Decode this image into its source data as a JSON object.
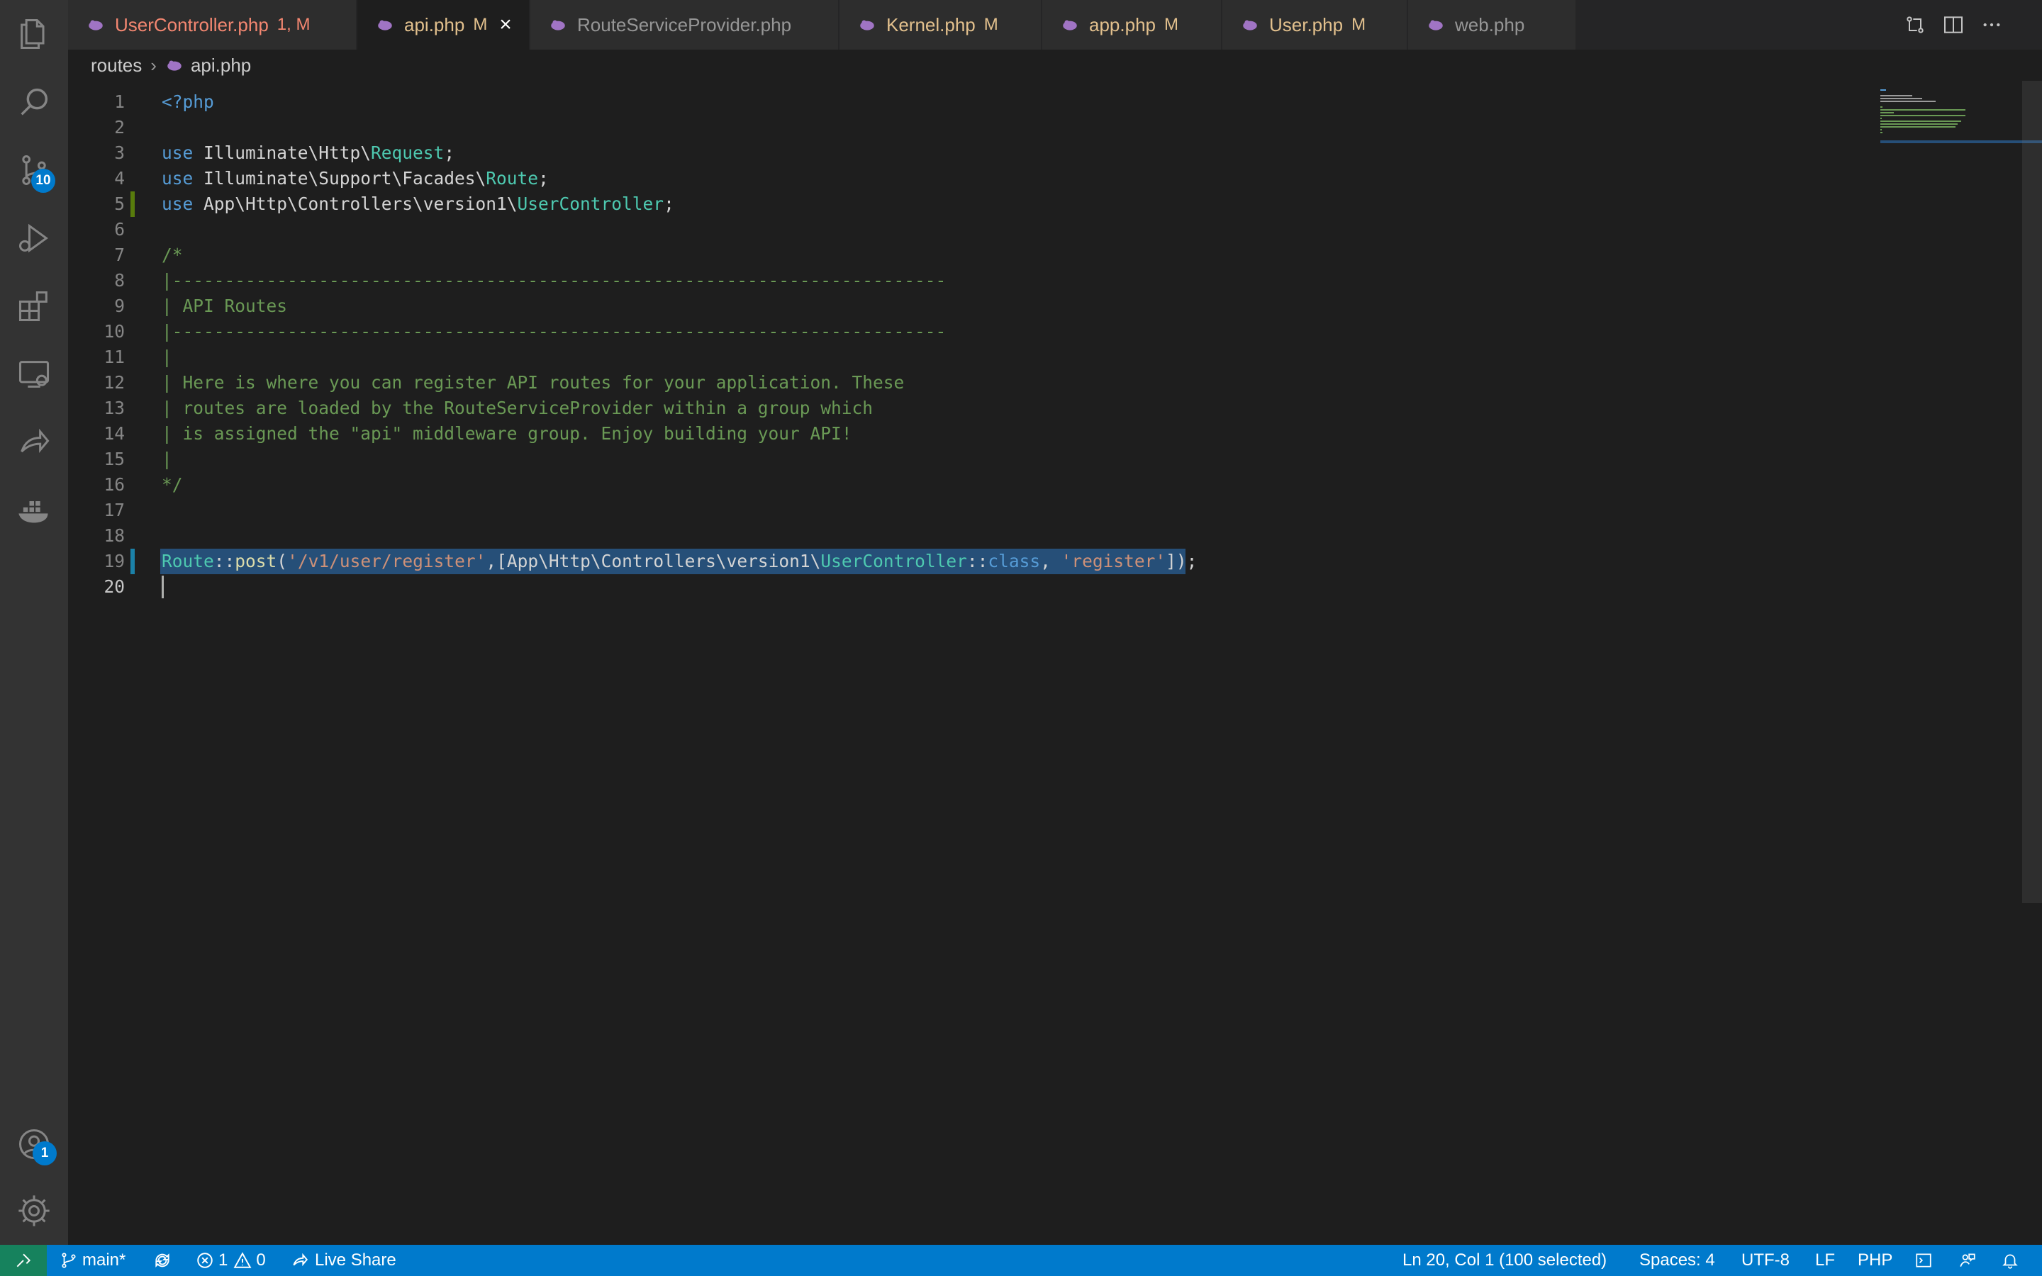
{
  "activity_bar": {
    "items": [
      {
        "name": "explorer-icon"
      },
      {
        "name": "search-icon"
      },
      {
        "name": "source-control-icon",
        "badge": "10"
      },
      {
        "name": "run-debug-icon"
      },
      {
        "name": "extensions-icon"
      },
      {
        "name": "remote-explorer-icon"
      },
      {
        "name": "live-share-icon"
      },
      {
        "name": "docker-icon"
      }
    ],
    "accounts": {
      "name": "accounts-icon",
      "badge": "1"
    },
    "settings": {
      "name": "gear-icon"
    }
  },
  "tabs": [
    {
      "label": "UserController.php",
      "status": "1, M",
      "color": "#f48771",
      "status_color": "#f48771",
      "active": false
    },
    {
      "label": "api.php",
      "status": "M",
      "color": "#e2c08d",
      "status_color": "#e2c08d",
      "active": true
    },
    {
      "label": "RouteServiceProvider.php",
      "status": "",
      "color": "#969696",
      "active": false
    },
    {
      "label": "Kernel.php",
      "status": "M",
      "color": "#e2c08d",
      "status_color": "#e2c08d",
      "active": false
    },
    {
      "label": "app.php",
      "status": "M",
      "color": "#e2c08d",
      "status_color": "#e2c08d",
      "active": false
    },
    {
      "label": "User.php",
      "status": "M",
      "color": "#e2c08d",
      "status_color": "#e2c08d",
      "active": false
    },
    {
      "label": "web.php",
      "status": "",
      "color": "#969696",
      "active": false
    }
  ],
  "tab_close": "×",
  "tab_actions": [
    "compare-changes-icon",
    "split-editor-icon",
    "more-actions-icon"
  ],
  "breadcrumb": {
    "folder": "routes",
    "file": "api.php"
  },
  "editor": {
    "lines": [
      {
        "n": "1",
        "text": "<?php"
      },
      {
        "n": "2",
        "text": ""
      },
      {
        "n": "3",
        "text": "use Illuminate\\Http\\Request;"
      },
      {
        "n": "4",
        "text": "use Illuminate\\Support\\Facades\\Route;"
      },
      {
        "n": "5",
        "text": "use App\\Http\\Controllers\\version1\\UserController;"
      },
      {
        "n": "6",
        "text": ""
      },
      {
        "n": "7",
        "text": "/*"
      },
      {
        "n": "8",
        "text": "|--------------------------------------------------------------------------"
      },
      {
        "n": "9",
        "text": "| API Routes"
      },
      {
        "n": "10",
        "text": "|--------------------------------------------------------------------------"
      },
      {
        "n": "11",
        "text": "|"
      },
      {
        "n": "12",
        "text": "| Here is where you can register API routes for your application. These"
      },
      {
        "n": "13",
        "text": "| routes are loaded by the RouteServiceProvider within a group which"
      },
      {
        "n": "14",
        "text": "| is assigned the \"api\" middleware group. Enjoy building your API!"
      },
      {
        "n": "15",
        "text": "|"
      },
      {
        "n": "16",
        "text": "*/"
      },
      {
        "n": "17",
        "text": ""
      },
      {
        "n": "18",
        "text": ""
      },
      {
        "n": "19",
        "text": "Route::post('/v1/user/register',[App\\Http\\Controllers\\version1\\UserController::class, 'register']);"
      },
      {
        "n": "20",
        "text": ""
      }
    ]
  },
  "colors": {
    "keyword": "#569cd6",
    "class": "#4ec9b0",
    "string": "#ce9178",
    "comment": "#6a9955",
    "selection": "#264f78",
    "status_bar": "#007acc"
  },
  "status_bar": {
    "branch": "main*",
    "errors": "1",
    "warnings": "0",
    "live_share": "Live Share",
    "cursor_position": "Ln 20, Col 1 (100 selected)",
    "indentation": "Spaces: 4",
    "encoding": "UTF-8",
    "eol": "LF",
    "language": "PHP"
  }
}
